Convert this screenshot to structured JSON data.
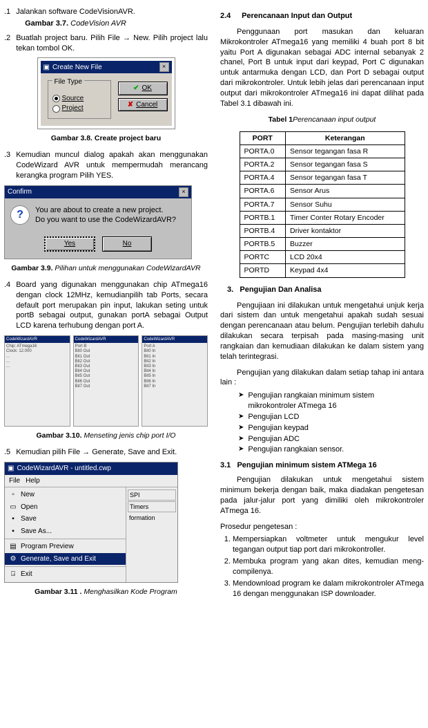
{
  "left": {
    "s1": {
      "num": ".1",
      "text_a": "Jalankan software CodeVisionAVR."
    },
    "cap37": {
      "b": "Gambar 3.7.",
      "i": "CodeVision AVR"
    },
    "s2": {
      "num": ".2",
      "text": "Buatlah project baru. Pilih File → New. Pilih project lalu tekan tombol OK."
    },
    "dlg_create": {
      "title": "Create New File",
      "legend": "File Type",
      "opt1": "Source",
      "opt2": "Project",
      "ok": "OK",
      "cancel": "Cancel"
    },
    "cap38": "Gambar 3.8. Create project baru",
    "s3": {
      "num": ".3",
      "text": "Kemudian muncul dialog apakah akan menggunakan CodeWizard AVR untuk mempermudah merancang kerangka program Pilih YES."
    },
    "confirm": {
      "title": "Confirm",
      "line1": "You are about to create a new project.",
      "line2": "Do you want to use the CodeWizardAVR?",
      "yes": "Yes",
      "no": "No"
    },
    "cap39": {
      "b": "Gambar 3.9.",
      "i": "Pilihan untuk menggunakan CodeWizardAVR"
    },
    "s4": {
      "num": ".4",
      "text": "Board yang digunakan menggunakan chip ATmega16 dengan clock 12MHz, kemudianpilih tab Ports, secara default port merupakan pin input, lakukan seting untuk portB sebagai output, gunakan portA sebagai Output LCD karena terhubung dengan port A."
    },
    "cap310": {
      "b": "Gambar 3.10.",
      "i": "Menseting jenis chip port I/O"
    },
    "s5": {
      "num": ".5",
      "text": "Kemudian pilih File → Generate, Save and Exit."
    },
    "wizard": {
      "title": "CodeWizardAVR - untitled.cwp",
      "menu_file": "File",
      "menu_help": "Help",
      "items": [
        "New",
        "Open",
        "Save",
        "Save As..."
      ],
      "items2": [
        "Program Preview",
        "Generate, Save and Exit"
      ],
      "items3": [
        "Exit"
      ],
      "side": [
        "SPI",
        "Timers",
        "formation"
      ]
    },
    "cap311": {
      "b": "Gambar 3.11 .",
      "i": "Menghasilkan Kode Program"
    }
  },
  "right": {
    "h24": {
      "num": "2.4",
      "title": "Perencanaan Input dan Output"
    },
    "p24": "Penggunaan port masukan dan keluaran Mikrokontroler ATmega16 yang memiliki 4 buah port 8 bit yaitu Port A digunakan sebagai ADC internal sebanyak 2 chanel, Port B untuk input dari keypad, Port C digunakan untuk antarmuka dengan LCD, dan Port D sebagai output dari mikrokontroler. Untuk lebih jelas dari perencanaan  input output dari mikrokontroler ATmega16 ini dapat dilihat pada Tabel 3.1 dibawah ini.",
    "tab1cap": {
      "b": "Tabel 1",
      "i": "Perencanaan input output"
    },
    "table": {
      "head": [
        "PORT",
        "Keterangan"
      ],
      "rows": [
        [
          "PORTA.0",
          "Sensor tegangan fasa R"
        ],
        [
          "PORTA.2",
          "Sensor tegangan fasa S"
        ],
        [
          "PORTA.4",
          "Sensor tegangan fasa T"
        ],
        [
          "PORTA.6",
          "Sensor Arus"
        ],
        [
          "PORTA.7",
          "Sensor Suhu"
        ],
        [
          "PORTB.1",
          "Timer Conter Rotary Encoder"
        ],
        [
          "PORTB.4",
          "Driver kontaktor"
        ],
        [
          "PORTB.5",
          "Buzzer"
        ],
        [
          "PORTC",
          "LCD 20x4"
        ],
        [
          "PORTD",
          "Keypad 4x4"
        ]
      ]
    },
    "h3": {
      "num": "3.",
      "title": "Pengujian Dan Analisa"
    },
    "p3a": "Pengujiaan ini dilakukan untuk mengetahui unjuk kerja dari sistem dan untuk mengetahui apakah sudah sesuai dengan perencanaan atau belum. Pengujian terlebih dahulu dilakukan secara terpisah pada masing-masing unit rangkaian dan kemudiaan dilakukan ke dalam sistem yang telah terintegrasi.",
    "p3b": "Pengujian yang dilakukan dalam setiap tahap ini antara lain :",
    "bullets": [
      "Pengujian rangkaian minimum sistem mikrokontroler ATmega 16",
      "Pengujian LCD",
      "Pengujian keypad",
      "Pengujian ADC",
      "Pengujian rangkaian sensor."
    ],
    "h31": {
      "num": "3.1",
      "title": "Pengujian minimum sistem ATMega 16"
    },
    "p31": "Pengujian dilakukan untuk mengetahui sistem minimum bekerja dengan baik, maka diadakan pengetesan pada jalur-jalur port yang dimiliki oleh mikrokontroler ATmega 16.",
    "proc_head": "Prosedur pengetesan :",
    "proc": [
      "Mempersiapkan voltmeter untuk mengukur level tegangan output  tiap port dari mikrokontroller.",
      "Membuka program yang akan dites, kemudian meng-  compilenya.",
      " Mendownload program ke dalam mikrokontroler ATmega 16 dengan menggunakan ISP downloader."
    ]
  }
}
